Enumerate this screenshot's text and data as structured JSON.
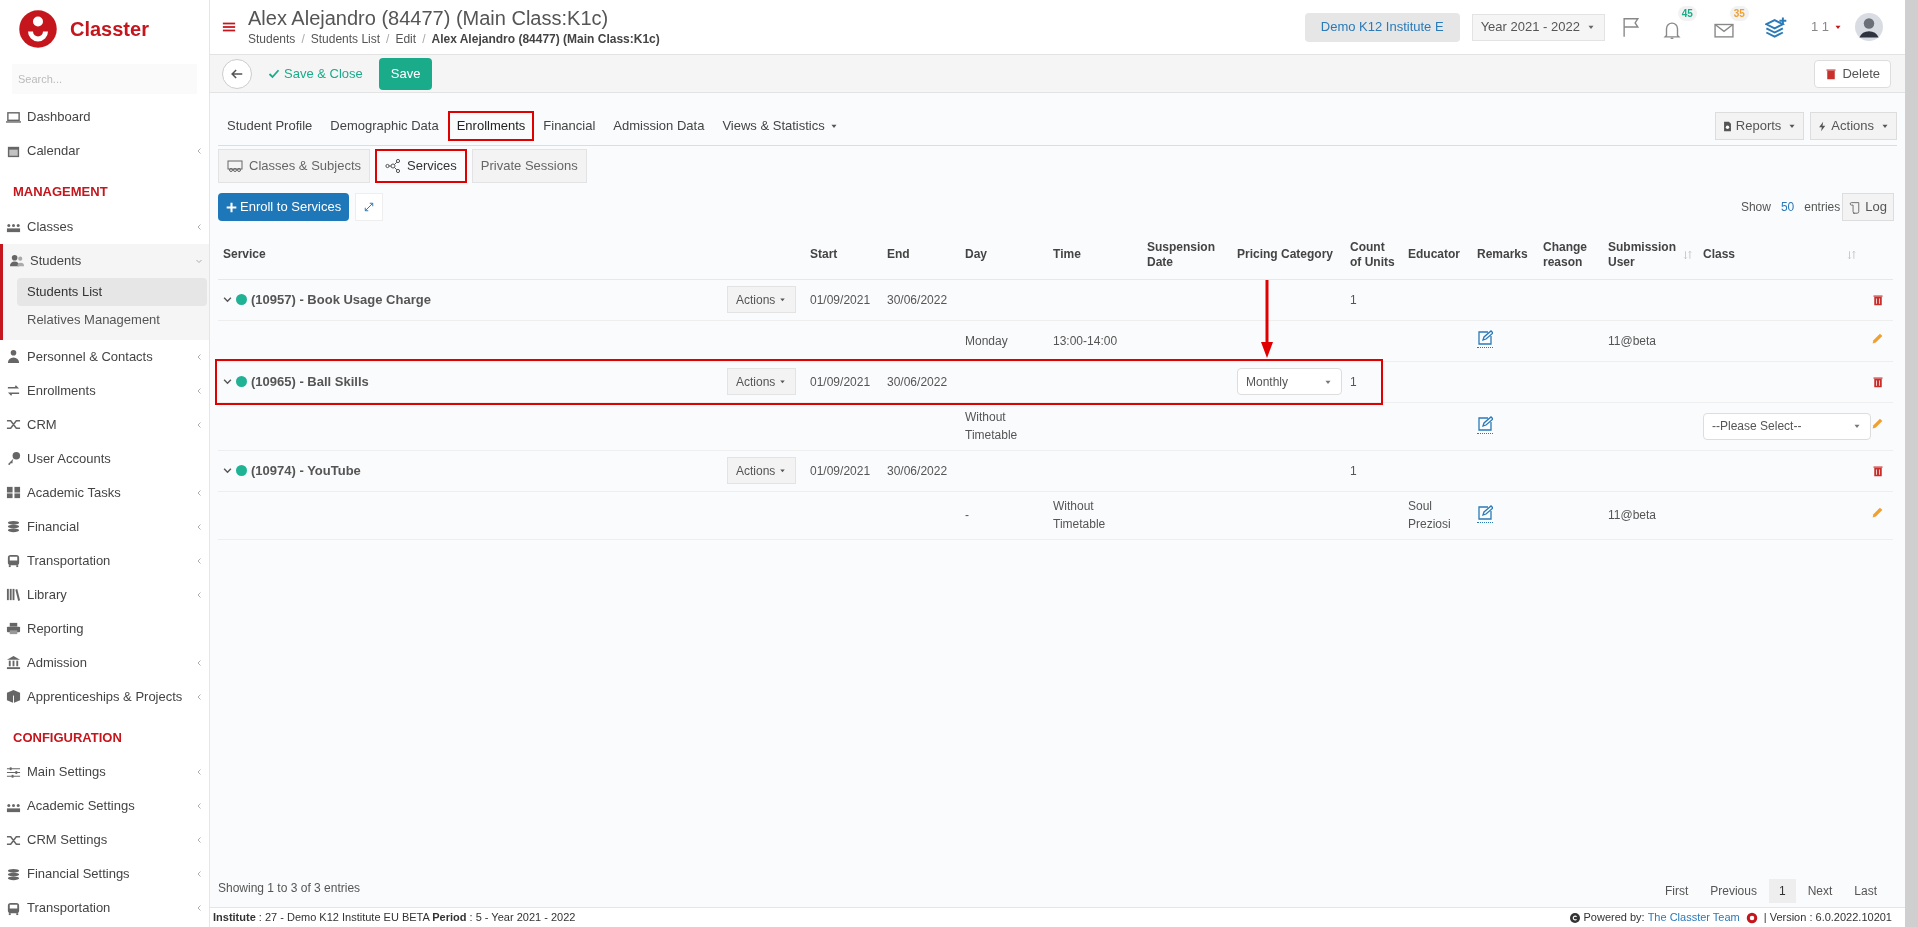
{
  "brand": {
    "name": "Classter"
  },
  "sidebar": {
    "search_placeholder": "Search...",
    "items": [
      {
        "kind": "item",
        "label": "Dashboard",
        "has_submenu": false
      },
      {
        "kind": "item",
        "label": "Calendar",
        "has_submenu": true
      },
      {
        "kind": "header",
        "label": "MANAGEMENT"
      },
      {
        "kind": "item",
        "label": "Classes",
        "has_submenu": true
      },
      {
        "kind": "item",
        "label": "Students",
        "has_submenu": true,
        "expanded": true,
        "children": [
          {
            "label": "Students List",
            "selected": true
          },
          {
            "label": "Relatives Management",
            "selected": false
          }
        ]
      },
      {
        "kind": "item",
        "label": "Personnel & Contacts",
        "has_submenu": true
      },
      {
        "kind": "item",
        "label": "Enrollments",
        "has_submenu": true
      },
      {
        "kind": "item",
        "label": "CRM",
        "has_submenu": true
      },
      {
        "kind": "item",
        "label": "User Accounts",
        "has_submenu": false
      },
      {
        "kind": "item",
        "label": "Academic Tasks",
        "has_submenu": true
      },
      {
        "kind": "item",
        "label": "Financial",
        "has_submenu": true
      },
      {
        "kind": "item",
        "label": "Transportation",
        "has_submenu": true
      },
      {
        "kind": "item",
        "label": "Library",
        "has_submenu": true
      },
      {
        "kind": "item",
        "label": "Reporting",
        "has_submenu": false
      },
      {
        "kind": "item",
        "label": "Admission",
        "has_submenu": true
      },
      {
        "kind": "item",
        "label": "Apprenticeships & Projects",
        "has_submenu": true
      },
      {
        "kind": "header",
        "label": "CONFIGURATION"
      },
      {
        "kind": "item",
        "label": "Main Settings",
        "has_submenu": true
      },
      {
        "kind": "item",
        "label": "Academic Settings",
        "has_submenu": true
      },
      {
        "kind": "item",
        "label": "CRM Settings",
        "has_submenu": true
      },
      {
        "kind": "item",
        "label": "Financial Settings",
        "has_submenu": true
      },
      {
        "kind": "item",
        "label": "Transportation",
        "has_submenu": true
      }
    ]
  },
  "header": {
    "title": "Alex Alejandro (84477) (Main Class:K1c)",
    "breadcrumb": [
      "Students",
      "Students List",
      "Edit",
      "Alex Alejandro (84477) (Main Class:K1c)"
    ],
    "breadcrumb_separator": "/",
    "institute": "Demo K12 Institute E",
    "year": "Year 2021 - 2022",
    "notifications": "45",
    "messages": "35",
    "user": "1 1"
  },
  "toolbar": {
    "save_close": "Save & Close",
    "save": "Save",
    "delete": "Delete"
  },
  "tabs": [
    {
      "label": "Student Profile",
      "selected": false,
      "highlighted": false
    },
    {
      "label": "Demographic Data",
      "selected": false,
      "highlighted": false
    },
    {
      "label": "Enrollments",
      "selected": true,
      "highlighted": true
    },
    {
      "label": "Financial",
      "selected": false,
      "highlighted": false
    },
    {
      "label": "Admission Data",
      "selected": false,
      "highlighted": false
    },
    {
      "label": "Views & Statistics",
      "selected": false,
      "highlighted": false,
      "dropdown": true
    }
  ],
  "tab_buttons": [
    "Reports",
    "Actions"
  ],
  "subtabs": [
    {
      "label": "Classes & Subjects",
      "selected": false,
      "highlighted": false
    },
    {
      "label": "Services",
      "selected": true,
      "highlighted": true
    },
    {
      "label": "Private Sessions",
      "selected": false,
      "highlighted": false
    }
  ],
  "enroll_button": "Enroll to Services",
  "show_entries": {
    "before": "Show",
    "value": "50",
    "after": "entries"
  },
  "log_button": "Log",
  "table": {
    "columns": [
      {
        "label": "Service",
        "sortable": false
      },
      {
        "label": "Start",
        "sortable": false
      },
      {
        "label": "End",
        "sortable": false
      },
      {
        "label": "Day",
        "sortable": false
      },
      {
        "label": "Time",
        "sortable": false
      },
      {
        "label": "Suspension Date",
        "sortable": false
      },
      {
        "label": "Pricing Category",
        "sortable": false
      },
      {
        "label": "Count of Units",
        "sortable": false
      },
      {
        "label": "Educator",
        "sortable": false
      },
      {
        "label": "Remarks",
        "sortable": false
      },
      {
        "label": "Change reason",
        "sortable": false
      },
      {
        "label": "Submission User",
        "sortable": true
      },
      {
        "label": "Class",
        "sortable": true
      }
    ],
    "rows": [
      {
        "kind": "service",
        "expanded": true,
        "name": "(10957) - Book Usage Charge",
        "actions": "Actions",
        "start": "01/09/2021",
        "end": "30/06/2022",
        "count": "1",
        "highlighted": false
      },
      {
        "kind": "detail",
        "day": "Monday",
        "time": "13:00-14:00",
        "submission_user": "11@beta"
      },
      {
        "kind": "service",
        "expanded": true,
        "name": "(10965) - Ball Skills",
        "actions": "Actions",
        "start": "01/09/2021",
        "end": "30/06/2022",
        "pricing": "Monthly",
        "count": "1",
        "highlighted": true
      },
      {
        "kind": "detail",
        "day": "Without Timetable",
        "class_select": "--Please Select--"
      },
      {
        "kind": "service",
        "expanded": true,
        "name": "(10974) - YouTube",
        "actions": "Actions",
        "start": "01/09/2021",
        "end": "30/06/2022",
        "count": "1",
        "highlighted": false
      },
      {
        "kind": "detail",
        "day": "-",
        "time": "Without Timetable",
        "educator": "Soul Preziosi",
        "submission_user": "11@beta"
      }
    ]
  },
  "annotation_arrow": true,
  "footer": {
    "summary": "Showing 1 to 3 of 3 entries",
    "pages": [
      {
        "label": "First",
        "selected": false
      },
      {
        "label": "Previous",
        "selected": false
      },
      {
        "label": "1",
        "selected": true
      },
      {
        "label": "Next",
        "selected": false
      },
      {
        "label": "Last",
        "selected": false
      }
    ]
  },
  "status_bar": {
    "info": "**Institute** : 27 - Demo K12 Institute EU BETA **Period** : 5 - Year 2021 - 2022",
    "powered": "Powered by:",
    "team": "The Classter Team",
    "version": "| Version : 6.0.2022.10201"
  }
}
